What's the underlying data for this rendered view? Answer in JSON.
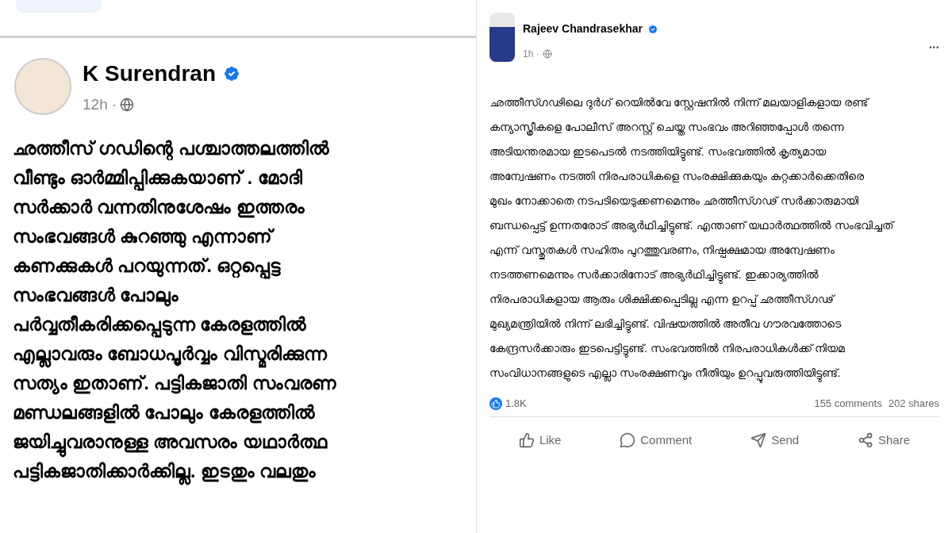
{
  "posts": [
    {
      "author": "K Surendran",
      "verified": true,
      "time": "12h ·",
      "text_lines": [
        "ഛത്തീസ് ഗഡിന്റെ പശ്ചാത്തലത്തിൽ",
        "വീണ്ടും ഓർമ്മിപ്പിക്കുകയാണ് . മോദി",
        "സർക്കാർ വന്നതിനുശേഷം ഇത്തരം",
        "സംഭവങ്ങൾ കുറഞ്ഞു എന്നാണ്",
        "കണക്കുകൾ പറയുന്നത്. ഒറ്റപ്പെട്ട",
        "സംഭവങ്ങൾ പോലും",
        "പർവ്വതീകരിക്കപ്പെടുന്ന കേരളത്തിൽ",
        "എല്ലാവരും ബോധപൂർവ്വം വിസ്മരിക്കുന്ന",
        "സത്യം ഇതാണ്. പട്ടികജാതി സംവരണ",
        "മണ്ഡലങ്ങളിൽ പോലും കേരളത്തിൽ",
        "ജയിച്ചുവരാനുള്ള അവസരം യഥാർത്ഥ",
        "പട്ടികജാതിക്കാർക്കില്ല. ഇടതും വലതും"
      ]
    },
    {
      "author": "Rajeev Chandrasekhar",
      "verified": true,
      "time": "1h ·",
      "text_lines": [
        "ഛത്തീസ്ഗഢിലെ ദുർഗ് റെയിൽവേ സ്റ്റേഷനിൽ നിന്ന് മലയാളികളായ രണ്ട്",
        "കന്യാസ്ത്രീകളെ പോലീസ് അറസ്റ്റ് ചെയ്ത സംഭവം അറിഞ്ഞപ്പോൾ തന്നെ",
        "അടിയന്തരമായ ഇടപെടൽ നടത്തിയിട്ടുണ്ട്. സംഭവത്തിൽ കൃത്യമായ",
        "അന്വേഷണം നടത്തി നിരപരാധികളെ സംരക്ഷിക്കുകയും കുറ്റക്കാർക്കെതിരെ",
        "മുഖം നോക്കാതെ നടപടിയെടുക്കണമെന്നും ഛത്തീസ്ഗഢ് സർക്കാരുമായി",
        "ബന്ധപ്പെട്ട് ഉന്നതരോട് അഭ്യർഥിച്ചിട്ടുണ്ട്. എന്താണ് യഥാർത്ഥത്തിൽ സംഭവിച്ചത്",
        "എന്ന് വസ്തുതകൾ സഹിതം പുറത്തുവരണം, നിഷ്പക്ഷമായ അന്വേഷണം",
        "നടത്തണമെന്നും സർക്കാരിനോട് അഭ്യർഥിച്ചിട്ടുണ്ട്. ഇക്കാര്യത്തിൽ",
        "നിരപരാധികളായ ആരും ശിക്ഷിക്കപ്പെടില്ല എന്ന ഉറപ്പ് ഛത്തീസ്ഗഢ്",
        "മുഖ്യമന്ത്രിയിൽ നിന്ന് ലഭിച്ചിട്ടുണ്ട്. വിഷയത്തിൽ അതീവ ഗൗരവത്തോടെ",
        "കേന്ദ്രസർക്കാരും ഇടപെട്ടിട്ടുണ്ട്. സംഭവത്തിൽ നിരപരാധികൾക്ക് നിയമ",
        "സംവിധാനങ്ങളുടെ എല്ലാ സംരക്ഷണവും നീതിയും ഉറപ്പുവരുത്തിയിട്ടുണ്ട്."
      ],
      "more": "...",
      "reactions": "1.8K",
      "comments": "155 comments",
      "shares": "202 shares",
      "actions": [
        "Like",
        "Comment",
        "Send",
        "Share"
      ]
    }
  ]
}
